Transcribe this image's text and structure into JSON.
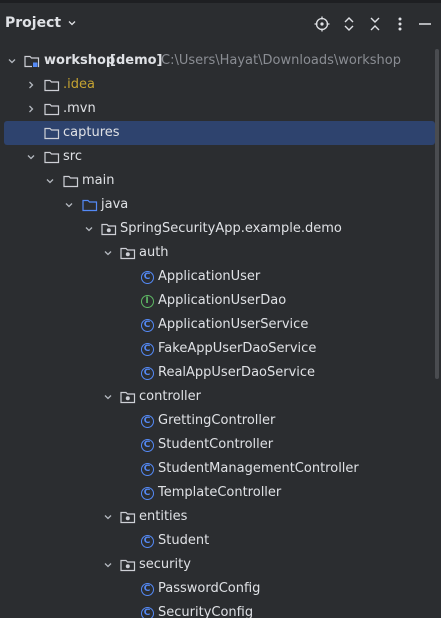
{
  "header": {
    "title": "Project",
    "icons": [
      "locate-icon",
      "expand-all-icon",
      "collapse-all-icon",
      "more-options-icon",
      "hide-icon"
    ]
  },
  "tree": {
    "root": {
      "name": "workshop",
      "module": "[demo]",
      "path": "C:\\Users\\Hayat\\Downloads\\workshop"
    },
    "idea": ".idea",
    "mvn": ".mvn",
    "captures": "captures",
    "src": "src",
    "main": "main",
    "java": "java",
    "package": "SpringSecurityApp.example.demo",
    "auth": {
      "name": "auth",
      "items": [
        "ApplicationUser",
        "ApplicationUserDao",
        "ApplicationUserService",
        "FakeAppUserDaoService",
        "RealAppUserDaoService"
      ]
    },
    "controller": {
      "name": "controller",
      "items": [
        "GrettingController",
        "StudentController",
        "StudentManagementController",
        "TemplateController"
      ]
    },
    "entities": {
      "name": "entities",
      "items": [
        "Student"
      ]
    },
    "security": {
      "name": "security",
      "items": [
        "PasswordConfig",
        "SecurityConfig"
      ]
    }
  },
  "icon_glyphs": {
    "class": "C",
    "interface": "I"
  },
  "colors": {
    "background": "#2b2d30",
    "selection": "#2e436e",
    "class_icon": "#548af7",
    "interface_icon": "#5fb865",
    "idea_folder_text": "#c5a332",
    "muted_path": "#8a8d93"
  }
}
